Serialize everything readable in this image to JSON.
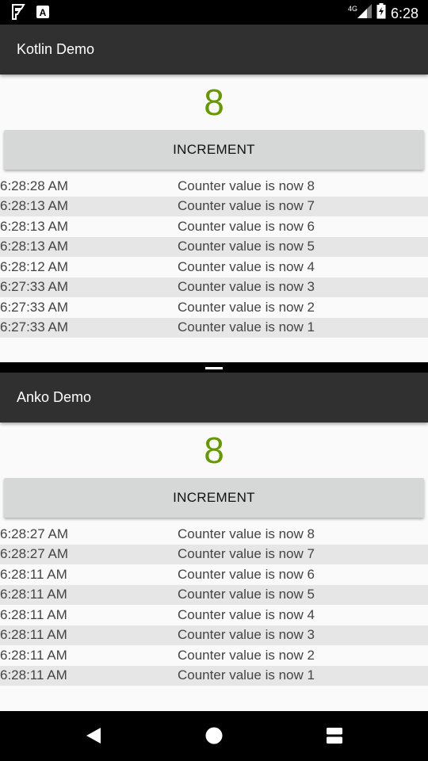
{
  "status_bar": {
    "time": "6:28",
    "network": "4G",
    "icons": [
      "notification-icon",
      "text-icon",
      "signal-icon",
      "battery-icon"
    ]
  },
  "top_pane": {
    "title": "Kotlin Demo",
    "counter": "8",
    "button_label": "INCREMENT",
    "log": [
      {
        "time": "6:28:28 AM",
        "message": "Counter value is now 8"
      },
      {
        "time": "6:28:13 AM",
        "message": "Counter value is now 7"
      },
      {
        "time": "6:28:13 AM",
        "message": "Counter value is now 6"
      },
      {
        "time": "6:28:13 AM",
        "message": "Counter value is now 5"
      },
      {
        "time": "6:28:12 AM",
        "message": "Counter value is now 4"
      },
      {
        "time": "6:27:33 AM",
        "message": "Counter value is now 3"
      },
      {
        "time": "6:27:33 AM",
        "message": "Counter value is now 2"
      },
      {
        "time": "6:27:33 AM",
        "message": "Counter value is now 1"
      }
    ]
  },
  "bottom_pane": {
    "title": "Anko Demo",
    "counter": "8",
    "button_label": "INCREMENT",
    "log": [
      {
        "time": "6:28:27 AM",
        "message": "Counter value is now 8"
      },
      {
        "time": "6:28:27 AM",
        "message": "Counter value is now 7"
      },
      {
        "time": "6:28:11 AM",
        "message": "Counter value is now 6"
      },
      {
        "time": "6:28:11 AM",
        "message": "Counter value is now 5"
      },
      {
        "time": "6:28:11 AM",
        "message": "Counter value is now 4"
      },
      {
        "time": "6:28:11 AM",
        "message": "Counter value is now 3"
      },
      {
        "time": "6:28:11 AM",
        "message": "Counter value is now 2"
      },
      {
        "time": "6:28:11 AM",
        "message": "Counter value is now 1"
      }
    ]
  },
  "nav_bar": {
    "icons": [
      "back-icon",
      "home-icon",
      "recents-icon"
    ]
  },
  "colors": {
    "app_bar": "#303030",
    "counter": "#669900",
    "button": "#d6d7d7",
    "background": "#fafafa",
    "row_stripe": "#e6e6e6"
  }
}
